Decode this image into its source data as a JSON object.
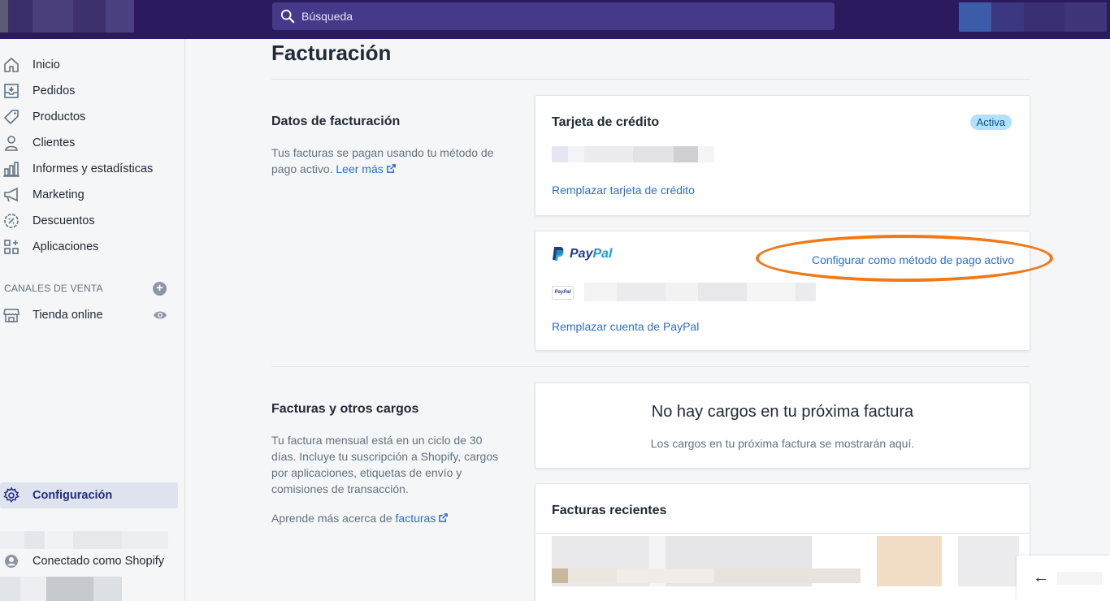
{
  "topbar": {
    "search_placeholder": "Búsqueda"
  },
  "sidebar": {
    "items": [
      {
        "label": "Inicio",
        "icon": "home-icon"
      },
      {
        "label": "Pedidos",
        "icon": "orders-icon"
      },
      {
        "label": "Productos",
        "icon": "tag-icon"
      },
      {
        "label": "Clientes",
        "icon": "person-icon"
      },
      {
        "label": "Informes y estadísticas",
        "icon": "chart-icon"
      },
      {
        "label": "Marketing",
        "icon": "megaphone-icon"
      },
      {
        "label": "Descuentos",
        "icon": "discount-icon"
      },
      {
        "label": "Aplicaciones",
        "icon": "apps-icon"
      }
    ],
    "sales_channels_title": "CANALES DE VENTA",
    "online_store_label": "Tienda online",
    "settings_label": "Configuración",
    "connected_label": "Conectado como Shopify"
  },
  "main": {
    "page_title": "Facturación",
    "billing": {
      "heading": "Datos de facturación",
      "text": "Tus facturas se pagan usando tu método de pago activo.",
      "learn_more": "Leer más"
    },
    "credit_card": {
      "title": "Tarjeta de crédito",
      "badge": "Activa",
      "replace_link": "Remplazar tarjeta de crédito"
    },
    "paypal": {
      "logo_text_1": "Pay",
      "logo_text_2": "Pal",
      "small_logo": "PayPal",
      "set_active_link": "Configurar como método de pago activo",
      "replace_link": "Remplazar cuenta de PayPal"
    },
    "invoices": {
      "heading": "Facturas y otros cargos",
      "text": "Tu factura mensual está en un ciclo de 30 días. Incluye tu suscripción a Shopify, cargos por aplicaciones, etiquetas de envío y comisiones de transacción.",
      "learn_prefix": "Aprende más acerca de",
      "learn_link": "facturas"
    },
    "next_bill": {
      "title": "No hay cargos en tu próxima factura",
      "text": "Los cargos en tu próxima factura se mostrarán aquí."
    },
    "recent": {
      "title": "Facturas recientes"
    }
  },
  "colors": {
    "topbar": "#2b1b5e",
    "accent_link": "#2c6ecb",
    "annotation_oval": "#f07a18"
  }
}
